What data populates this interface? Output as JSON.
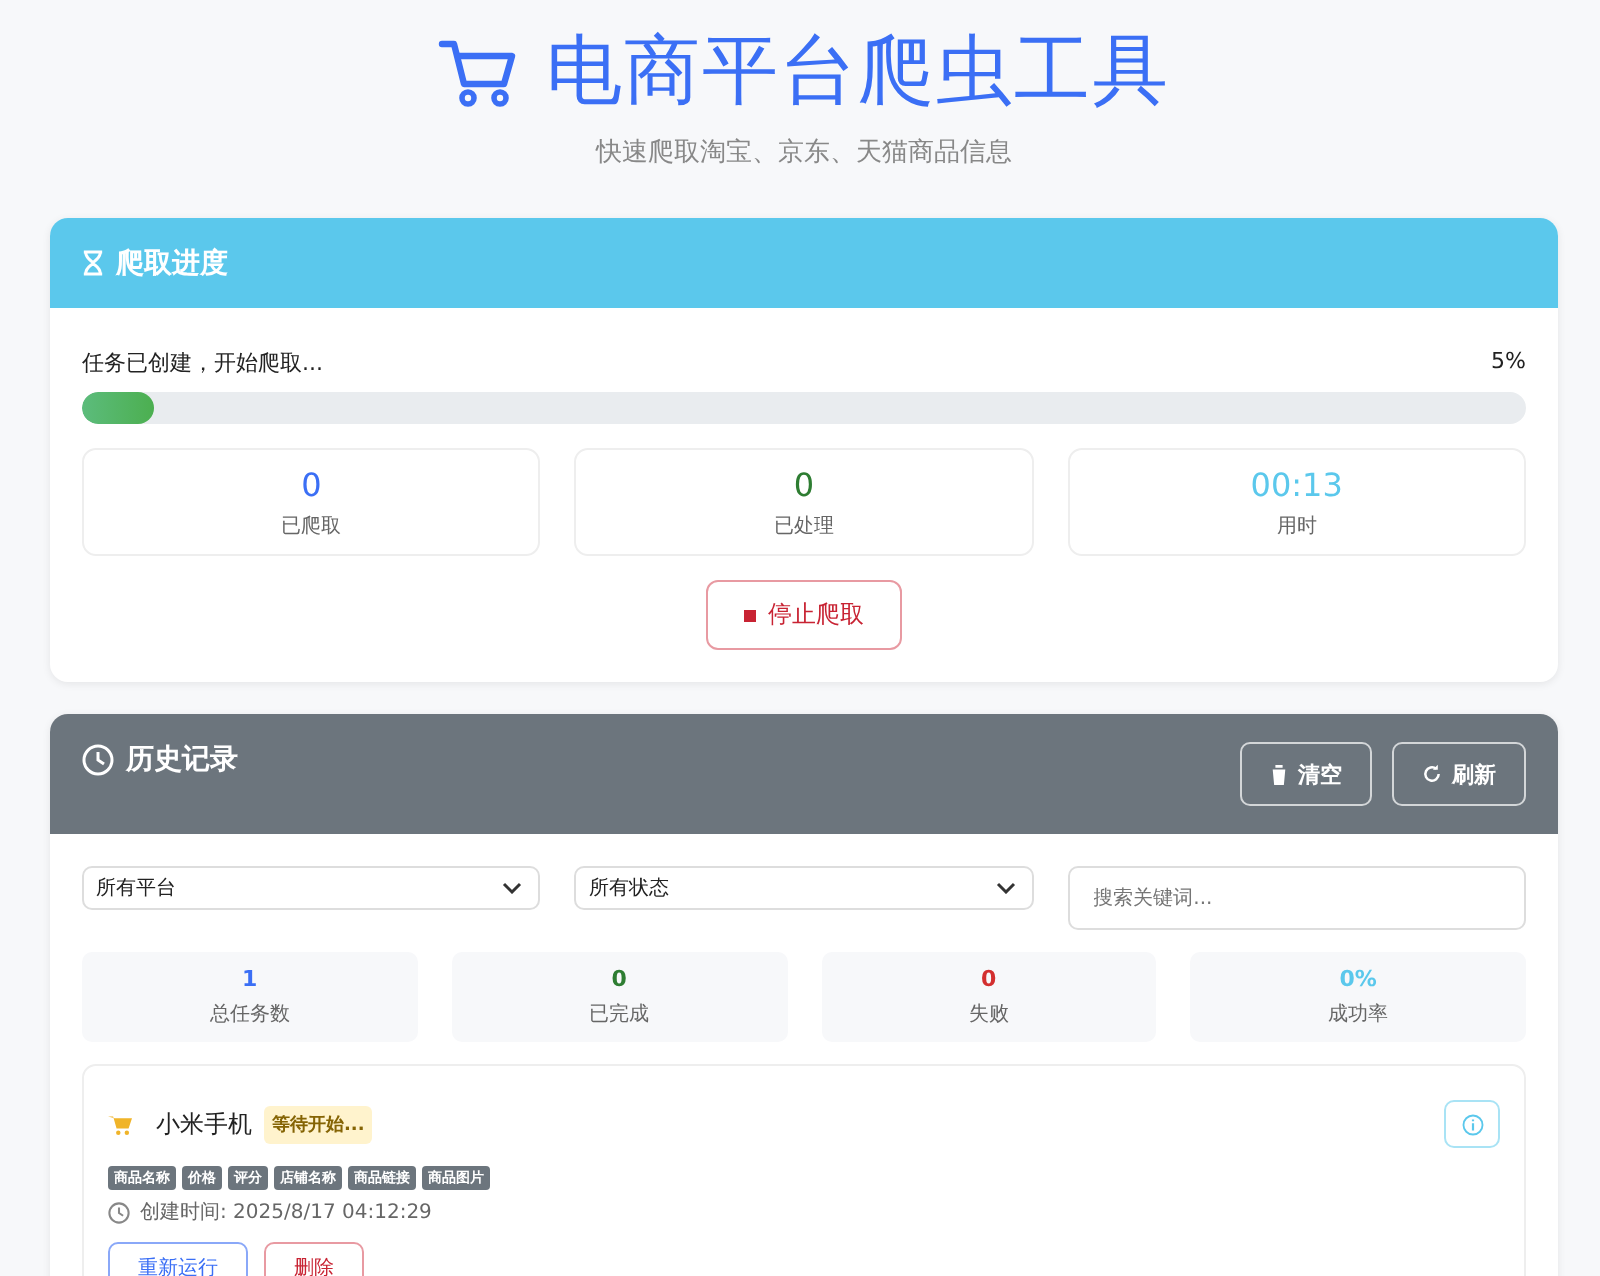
{
  "header": {
    "title": "电商平台爬虫工具",
    "subtitle": "快速爬取淘宝、京东、天猫商品信息"
  },
  "progress": {
    "title": "爬取进度",
    "status": "任务已创建，开始爬取...",
    "percent": "5%",
    "level": 0.05,
    "stats": [
      {
        "value": "0",
        "label": "已爬取",
        "color": "#3b6ff5"
      },
      {
        "value": "0",
        "label": "已处理",
        "color": "#2e7d32"
      },
      {
        "value": "00:13",
        "label": "用时",
        "color": "#5bc8ec"
      }
    ],
    "stop_button": "停止爬取"
  },
  "history": {
    "title": "历史记录",
    "buttons": [
      {
        "label": "清空",
        "kind": "clear"
      },
      {
        "label": "刷新",
        "kind": "refresh"
      }
    ],
    "filters": [
      {
        "value": "所有平台"
      },
      {
        "value": "所有状态"
      }
    ],
    "search": {
      "placeholder": "搜索关键词..."
    },
    "summary": [
      {
        "value": "1",
        "label": "总任务数",
        "color": "#3b6ff5"
      },
      {
        "value": "0",
        "label": "已完成",
        "color": "#2e7d32"
      },
      {
        "value": "0",
        "label": "失败",
        "color": "#d32f2f"
      },
      {
        "value": "0%",
        "label": "成功率",
        "color": "#5bc8ec"
      }
    ],
    "tasks": [
      {
        "name": "小米手机",
        "status": "等待开始...",
        "fields": [
          "商品名称",
          "价格",
          "评分",
          "店铺名称",
          "商品链接",
          "商品图片"
        ],
        "created": "创建时间: 2025/8/17 04:12:29",
        "actions": [
          {
            "label": "重新运行",
            "kind": "rerun"
          },
          {
            "label": "删除",
            "kind": "delete"
          }
        ]
      }
    ]
  }
}
